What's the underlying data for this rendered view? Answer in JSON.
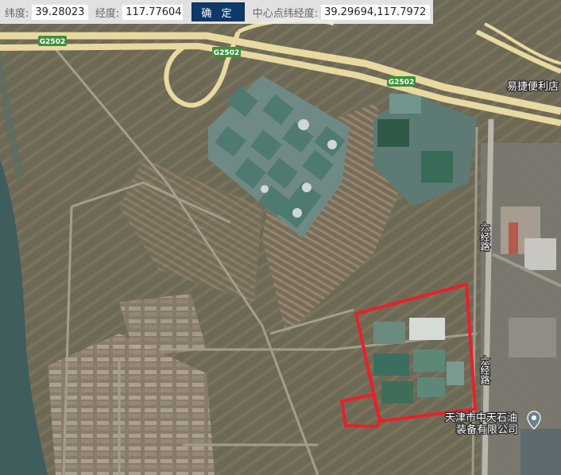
{
  "toolbar": {
    "lat_label": "纬度:",
    "lat_value": "39.28023",
    "lng_label": "经度:",
    "lng_value": "117.77604",
    "confirm_label": "确 定",
    "center_label": "中心点纬经度:",
    "center_value": "39.29694,117.7972"
  },
  "map": {
    "road_shields": [
      "G2502",
      "G2502",
      "G2502"
    ],
    "road_name": "六经路",
    "pois": [
      {
        "name": "易捷便利店"
      },
      {
        "name_line1": "天津市中天石油",
        "name_line2": "装备有限公司",
        "icon": "location-pin-icon"
      }
    ],
    "highlight_color": "#e8202a",
    "highway_color": "#e8d9a0",
    "shield_color": "#3f8f3a"
  }
}
